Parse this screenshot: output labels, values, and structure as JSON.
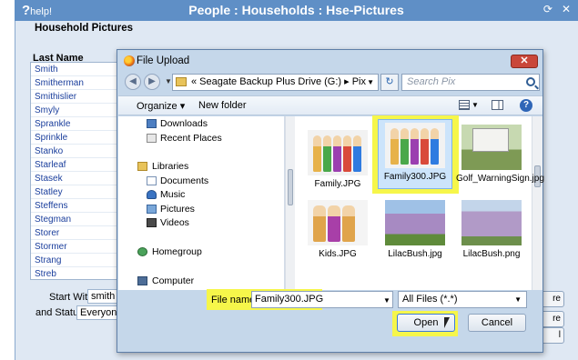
{
  "app": {
    "help_label": "help!",
    "title": "People : Households : Hse-Pictures",
    "section_title": "Household Pictures",
    "last_name_header": "Last Name",
    "names": [
      "Smith",
      "Smitherman",
      "Smithislier",
      "Smyly",
      "Sprankle",
      "Sprinkle",
      "Stanko",
      "Starleaf",
      "Stasek",
      "Statley",
      "Steffens",
      "Stegman",
      "Storer",
      "Stormer",
      "Strang",
      "Streb"
    ],
    "start_with_label": "Start With",
    "start_with_value": "smith",
    "status_label": "and Status of",
    "status_value": "Everyone",
    "behind_buttons": [
      "re",
      "re",
      "l"
    ]
  },
  "dialog": {
    "title": "File Upload",
    "close_label": "✕",
    "address_path": "«  Seagate Backup Plus Drive (G:)  ▸  Pix",
    "search_placeholder": "Search Pix",
    "toolbar": {
      "organize": "Organize ▾",
      "new_folder": "New folder"
    },
    "nav_items": {
      "downloads": "Downloads",
      "recent": "Recent Places",
      "libraries": "Libraries",
      "documents": "Documents",
      "music": "Music",
      "pictures": "Pictures",
      "videos": "Videos",
      "homegroup": "Homegroup",
      "computer": "Computer"
    },
    "files": [
      "Family.JPG",
      "Family300.JPG",
      "Golf_WarningSign.jpg",
      "Kids.JPG",
      "LilacBush.jpg",
      "LilacBush.png"
    ],
    "selected_file": "Family300.JPG",
    "file_name_label": "File name:",
    "file_name_value": "Family300.JPG",
    "file_type": "All Files (*.*)",
    "open_label": "Open",
    "cancel_label": "Cancel"
  }
}
